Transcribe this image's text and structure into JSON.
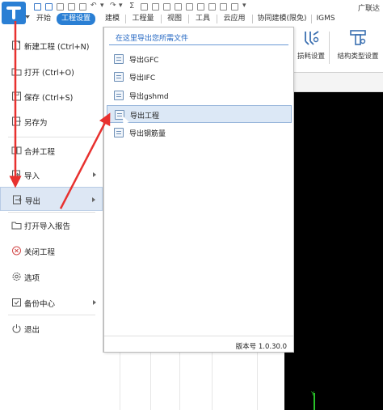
{
  "quick_access": {
    "sigma": "Σ",
    "dropdown": "▾"
  },
  "tabs": [
    {
      "label": "开始"
    },
    {
      "label": "工程设置"
    },
    {
      "label": "建模"
    },
    {
      "label": "工程量"
    },
    {
      "label": "视图"
    },
    {
      "label": "工具"
    },
    {
      "label": "云应用"
    },
    {
      "label": "协同建模(限免)"
    },
    {
      "label": "IGMS"
    }
  ],
  "brand_text": "广联达",
  "ribbon": {
    "items": [
      {
        "label": "损耗设置",
        "icon": "loss-setting-icon"
      },
      {
        "label": "结构类型设置",
        "icon": "structure-type-icon"
      }
    ]
  },
  "app_menu": {
    "items": [
      {
        "label": "新建工程 (Ctrl+N)",
        "icon": "new-project-icon"
      },
      {
        "label": "打开 (Ctrl+O)",
        "icon": "open-folder-icon"
      },
      {
        "label": "保存 (Ctrl+S)",
        "icon": "save-icon"
      },
      {
        "label": "另存为",
        "icon": "save-as-icon"
      },
      {
        "label": "合并工程",
        "icon": "merge-icon"
      },
      {
        "label": "导入",
        "icon": "import-icon"
      },
      {
        "label": "导出",
        "icon": "export-icon"
      },
      {
        "label": "打开导入报告",
        "icon": "report-folder-icon"
      },
      {
        "label": "关闭工程",
        "icon": "close-circle-icon"
      },
      {
        "label": "选项",
        "icon": "gear-icon"
      },
      {
        "label": "备份中心",
        "icon": "backup-icon"
      },
      {
        "label": "退出",
        "icon": "power-icon"
      }
    ]
  },
  "submenu": {
    "header": "在这里导出您所需文件",
    "items": [
      {
        "label": "导出GFC"
      },
      {
        "label": "导出IFC"
      },
      {
        "label": "导出gshmd"
      },
      {
        "label": "导出工程"
      },
      {
        "label": "导出钢筋量"
      }
    ],
    "version": "版本号 1.0.30.0"
  },
  "colors": {
    "accent": "#2a7fd4",
    "annotation": "#e8312f",
    "selection": "#dde7f4"
  },
  "axis_label": "Y"
}
